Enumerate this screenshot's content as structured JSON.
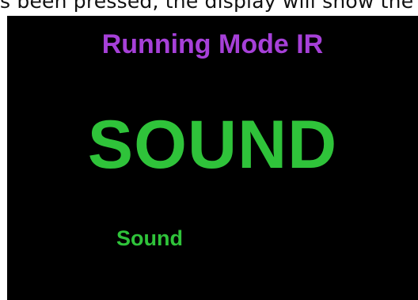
{
  "caption": {
    "text": "s been pressed, the display will show the"
  },
  "display": {
    "title": "Running Mode IR",
    "main_status": "SOUND",
    "sub_status": "Sound"
  },
  "colors": {
    "background": "#000000",
    "title": "#a640d8",
    "status": "#2fc33a"
  }
}
